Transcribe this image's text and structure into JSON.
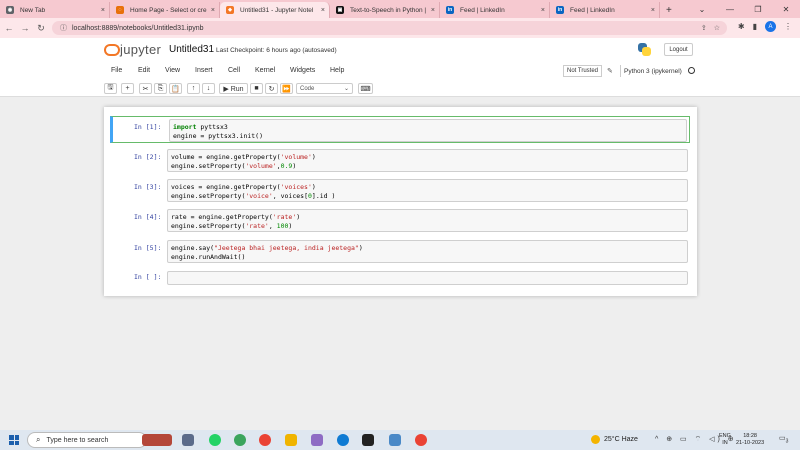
{
  "browser": {
    "tabs": [
      {
        "label": "New Tab",
        "close": "×",
        "fav_color": "#5f6368",
        "fav_glyph": "◉"
      },
      {
        "label": "Home Page - Select or cre",
        "close": "×",
        "fav_color": "#e8710a",
        "fav_glyph": "◌"
      },
      {
        "label": "Untitled31 - Jupyter Notel",
        "close": "×",
        "fav_color": "#f37726",
        "fav_glyph": "◆",
        "active": true
      },
      {
        "label": "Text-to-Speech in Python |",
        "close": "×",
        "fav_color": "#111111",
        "fav_glyph": "▣"
      },
      {
        "label": "Feed | LinkedIn",
        "close": "×",
        "fav_color": "#0a66c2",
        "fav_glyph": "in"
      },
      {
        "label": "Feed | LinkedIn",
        "close": "×",
        "fav_color": "#0a66c2",
        "fav_glyph": "in"
      }
    ],
    "new_tab_glyph": "+",
    "window_controls": {
      "dropdown": "⌄",
      "minimize": "—",
      "maximize": "❐",
      "close": "✕"
    },
    "nav": {
      "back": "←",
      "forward": "→",
      "reload": "↻"
    },
    "url": "localhost:8889/notebooks/Untitled31.ipynb",
    "url_lock": "ⓘ",
    "url_icons": {
      "share": "⇪",
      "star": "☆"
    },
    "right_icons": {
      "extensions": "✱",
      "sidebar": "▮",
      "profile": "A",
      "menu": "⋮"
    }
  },
  "jupyter": {
    "logo_text": "jupyter",
    "notebook_name": "Untitled31",
    "checkpoint": "Last Checkpoint: 6 hours ago  (autosaved)",
    "logout": "Logout",
    "menu": [
      "File",
      "Edit",
      "View",
      "Insert",
      "Cell",
      "Kernel",
      "Widgets",
      "Help"
    ],
    "trusted": "Not Trusted",
    "pencil": "✎",
    "kernel": "Python 3 (ipykernel)",
    "toolbar": {
      "save": "🖫",
      "add": "+",
      "cut": "✂",
      "copy": "⎘",
      "paste": "📋",
      "up": "↑",
      "down": "↓",
      "run": "▶ Run",
      "stop": "■",
      "restart": "↻",
      "fastforward": "⏩",
      "cell_type": "Code",
      "cell_type_caret": "⌄",
      "keyboard": "⌨"
    }
  },
  "cells": [
    {
      "prompt": "In [1]:",
      "lines": [
        "import pyttsx3",
        "engine = pyttsx3.init()"
      ]
    },
    {
      "prompt": "In [2]:",
      "lines": [
        "volume = engine.getProperty('volume')",
        "engine.setProperty('volume',0.9)"
      ]
    },
    {
      "prompt": "In [3]:",
      "lines": [
        "voices = engine.getProperty('voices')",
        "engine.setProperty('voice', voices[0].id )"
      ]
    },
    {
      "prompt": "In [4]:",
      "lines": [
        "rate = engine.getProperty('rate')",
        "engine.setProperty('rate', 100)"
      ]
    },
    {
      "prompt": "In [5]:",
      "lines": [
        "engine.say(\"Jeetega bhai jeetega, india jeetega\")",
        "engine.runAndWait()"
      ]
    },
    {
      "prompt": "In [ ]:",
      "lines": [
        ""
      ]
    }
  ],
  "taskbar": {
    "search_placeholder": "Type here to search",
    "search_glyph": "⌕",
    "weather": "25°C  Haze",
    "tray_icons": "^ ⊕ ▭ ⌔ ◁) ⊕",
    "lang_1": "ENG",
    "lang_2": "IN",
    "time": "18:28",
    "date": "21-10-2023",
    "notification": "▭",
    "notification_count": "3"
  }
}
